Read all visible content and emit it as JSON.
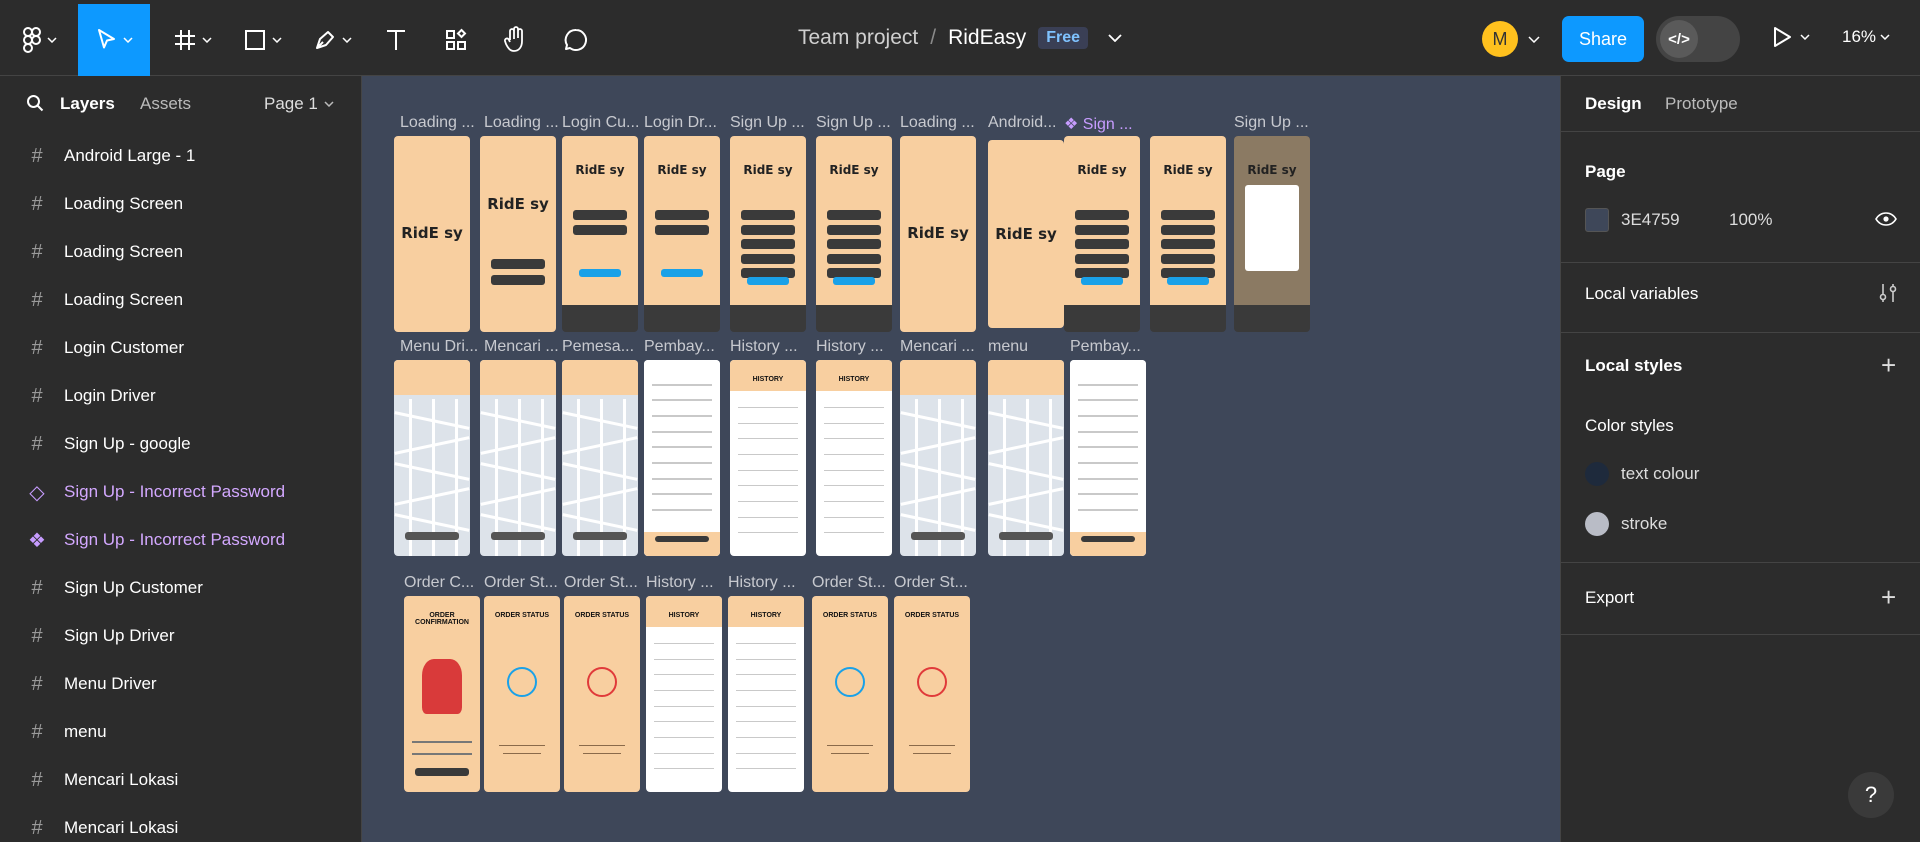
{
  "toolbar": {
    "breadcrumb_team": "Team project",
    "breadcrumb_sep": "/",
    "file_name": "RidEasy",
    "plan_badge": "Free",
    "avatar_initial": "M",
    "share_label": "Share",
    "dev_mode_icon": "</>",
    "zoom_level": "16%"
  },
  "left_panel": {
    "tab_layers": "Layers",
    "tab_assets": "Assets",
    "page_selector": "Page 1",
    "layers": [
      {
        "label": "Android Large - 1",
        "icon": "frame-icon"
      },
      {
        "label": "Loading Screen",
        "icon": "frame-icon"
      },
      {
        "label": "Loading Screen",
        "icon": "frame-icon"
      },
      {
        "label": "Loading Screen",
        "icon": "frame-icon"
      },
      {
        "label": "Login Customer",
        "icon": "frame-icon"
      },
      {
        "label": "Login Driver",
        "icon": "frame-icon"
      },
      {
        "label": "Sign Up - google",
        "icon": "frame-icon"
      },
      {
        "label": "Sign Up - Incorrect Password",
        "icon": "instance-icon"
      },
      {
        "label": "Sign Up - Incorrect Password",
        "icon": "component-icon"
      },
      {
        "label": "Sign Up Customer",
        "icon": "frame-icon"
      },
      {
        "label": "Sign Up Driver",
        "icon": "frame-icon"
      },
      {
        "label": "Menu Driver",
        "icon": "frame-icon"
      },
      {
        "label": "menu",
        "icon": "frame-icon"
      },
      {
        "label": "Mencari Lokasi",
        "icon": "frame-icon"
      },
      {
        "label": "Mencari Lokasi",
        "icon": "frame-icon"
      }
    ]
  },
  "canvas": {
    "row1_labels": [
      "Loading ...",
      "Loading ...",
      "Login Cu...",
      "Login Dr...",
      "Sign Up ...",
      "Sign Up ...",
      "Loading ...",
      "Android...",
      "❖ Sign ...",
      "Sign Up ..."
    ],
    "row2_labels": [
      "Menu Dri...",
      "Mencari ...",
      "Pemesa...",
      "Pembay...",
      "History ...",
      "History ...",
      "Mencari ...",
      "menu",
      "Pembay..."
    ],
    "row3_labels": [
      "Order C...",
      "Order St...",
      "Order St...",
      "History ...",
      "History ...",
      "Order St...",
      "Order St..."
    ],
    "logo_text": "RidE sy",
    "order_status_title": "ORDER STATUS",
    "order_confirm_title": "ORDER CONFIRMATION",
    "history_title": "HISTORY"
  },
  "right_panel": {
    "tab_design": "Design",
    "tab_prototype": "Prototype",
    "page_heading": "Page",
    "page_color_hex": "3E4759",
    "page_opacity": "100%",
    "local_variables": "Local variables",
    "local_styles": "Local styles",
    "color_styles_heading": "Color styles",
    "color_styles": [
      {
        "name": "text colour",
        "color": "#1e2a3c"
      },
      {
        "name": "stroke",
        "color": "#b9bcc6"
      }
    ],
    "export_label": "Export"
  },
  "colors": {
    "accent": "#0d99ff",
    "canvas_bg": "#3e4759",
    "frame_peach": "#f8cfa0",
    "component_purple": "#c79cff"
  },
  "help_label": "?"
}
